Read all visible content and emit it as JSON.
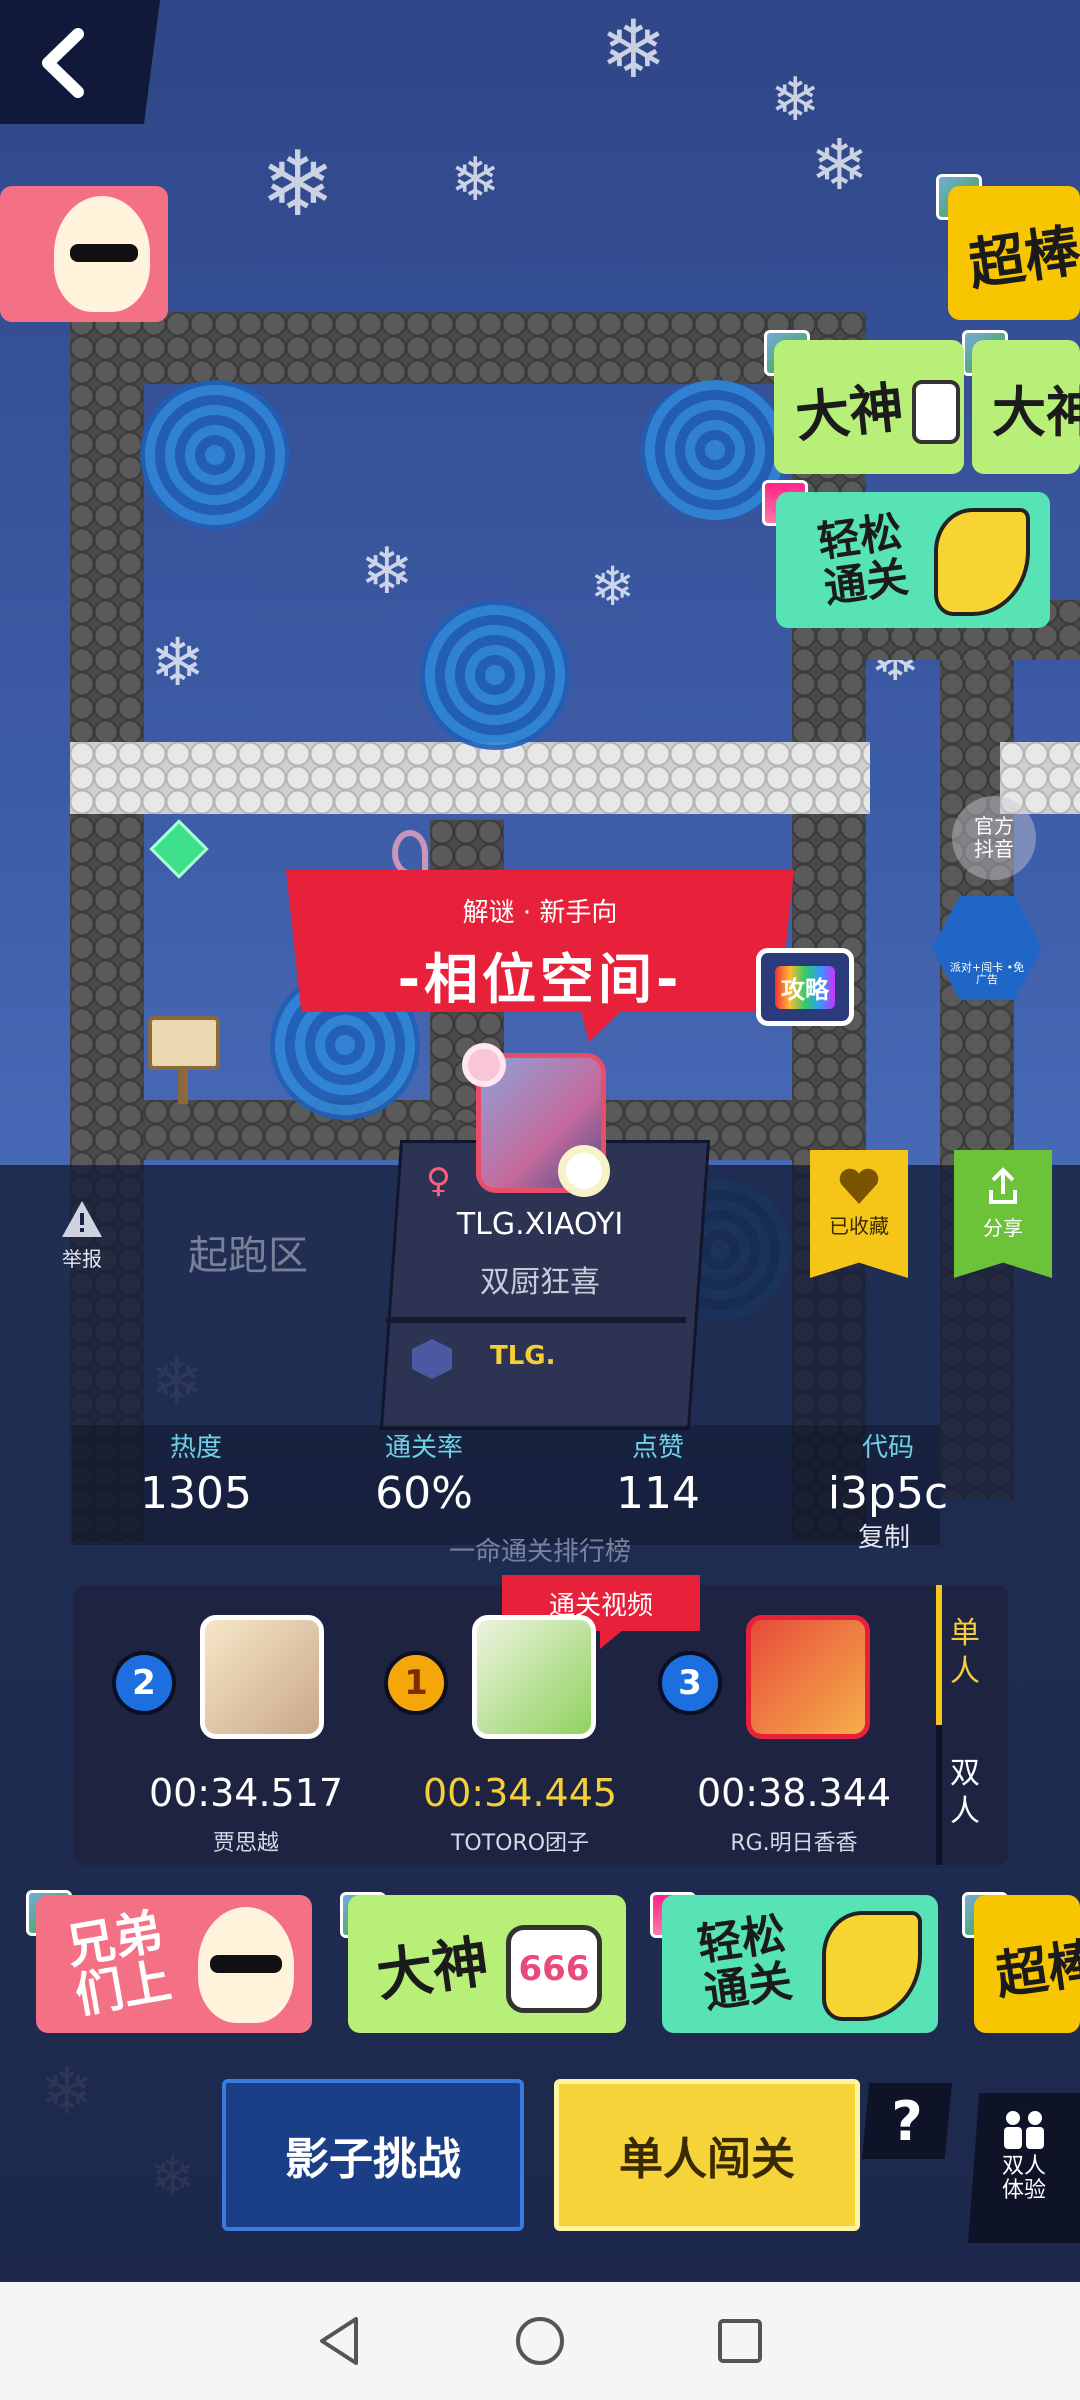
{
  "level": {
    "tags": "解谜 · 新手向",
    "title": "-相位空间-",
    "strategy_label": "攻略",
    "start_zone_label": "起跑区"
  },
  "author": {
    "gender_symbol": "♀",
    "name": "TLG.XIAOYI",
    "subtitle": "双厨狂喜",
    "team": "TLG."
  },
  "side_buttons": {
    "report": "举报",
    "favorite": "已收藏",
    "share": "分享",
    "official_douyin": "官方\n抖音",
    "promo_badge": "派对+闯卡 •免广告"
  },
  "stats": [
    {
      "label": "热度",
      "value": "1305"
    },
    {
      "label": "通关率",
      "value": "60%"
    },
    {
      "label": "点赞",
      "value": "114"
    },
    {
      "label": "代码",
      "value": "i3p5c"
    }
  ],
  "copy_label": "复制",
  "leaderboard": {
    "title": "一命通关排行榜",
    "video_tag": "通关视频",
    "tabs": [
      "单人",
      "双人"
    ],
    "entries": [
      {
        "rank": "2",
        "time": "00:34.517",
        "name": "贾思越"
      },
      {
        "rank": "1",
        "time": "00:34.445",
        "name": "TOTORO团子"
      },
      {
        "rank": "3",
        "time": "00:38.344",
        "name": "RG.明日香香"
      }
    ]
  },
  "stickers_top": {
    "s1": "超棒",
    "s2": "大神",
    "s3": "大神",
    "s4": "轻松\n通关"
  },
  "stickers_bottom": {
    "s1": "兄弟\n们上",
    "s2": "大神",
    "s2_badge": "666",
    "s3": "轻松\n通关",
    "s4": "超棒"
  },
  "actions": {
    "shadow_challenge": "影子挑战",
    "single_play": "单人闯关",
    "help": "?",
    "duo_trial": "双人\n体验"
  },
  "colors": {
    "red_banner": "#e8213b",
    "gold": "#f5c518",
    "share_green": "#6cc33a",
    "accent_time": "#f5cf3a"
  }
}
